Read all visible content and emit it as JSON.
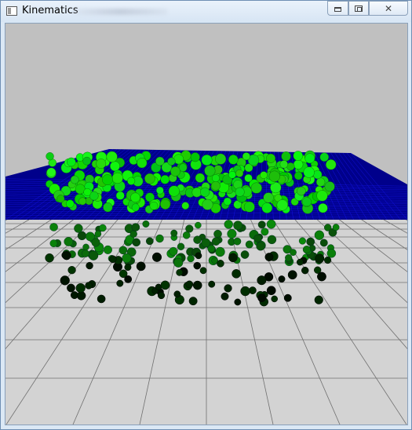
{
  "window": {
    "title": "Kinematics",
    "controls": {
      "minimize_icon": "minimize-icon",
      "maximize_icon": "restore-icon",
      "close_icon": "close-icon",
      "close_glyph": "✕"
    }
  },
  "scene": {
    "background_color": "#c0c0c0",
    "floor_color": "#d3d3d3",
    "floor_grid_color": "#707070",
    "water_color": "#00008b",
    "water_grid_color": "#1a1aff",
    "particle_colors": [
      "#00d000",
      "#008000",
      "#003300"
    ]
  }
}
